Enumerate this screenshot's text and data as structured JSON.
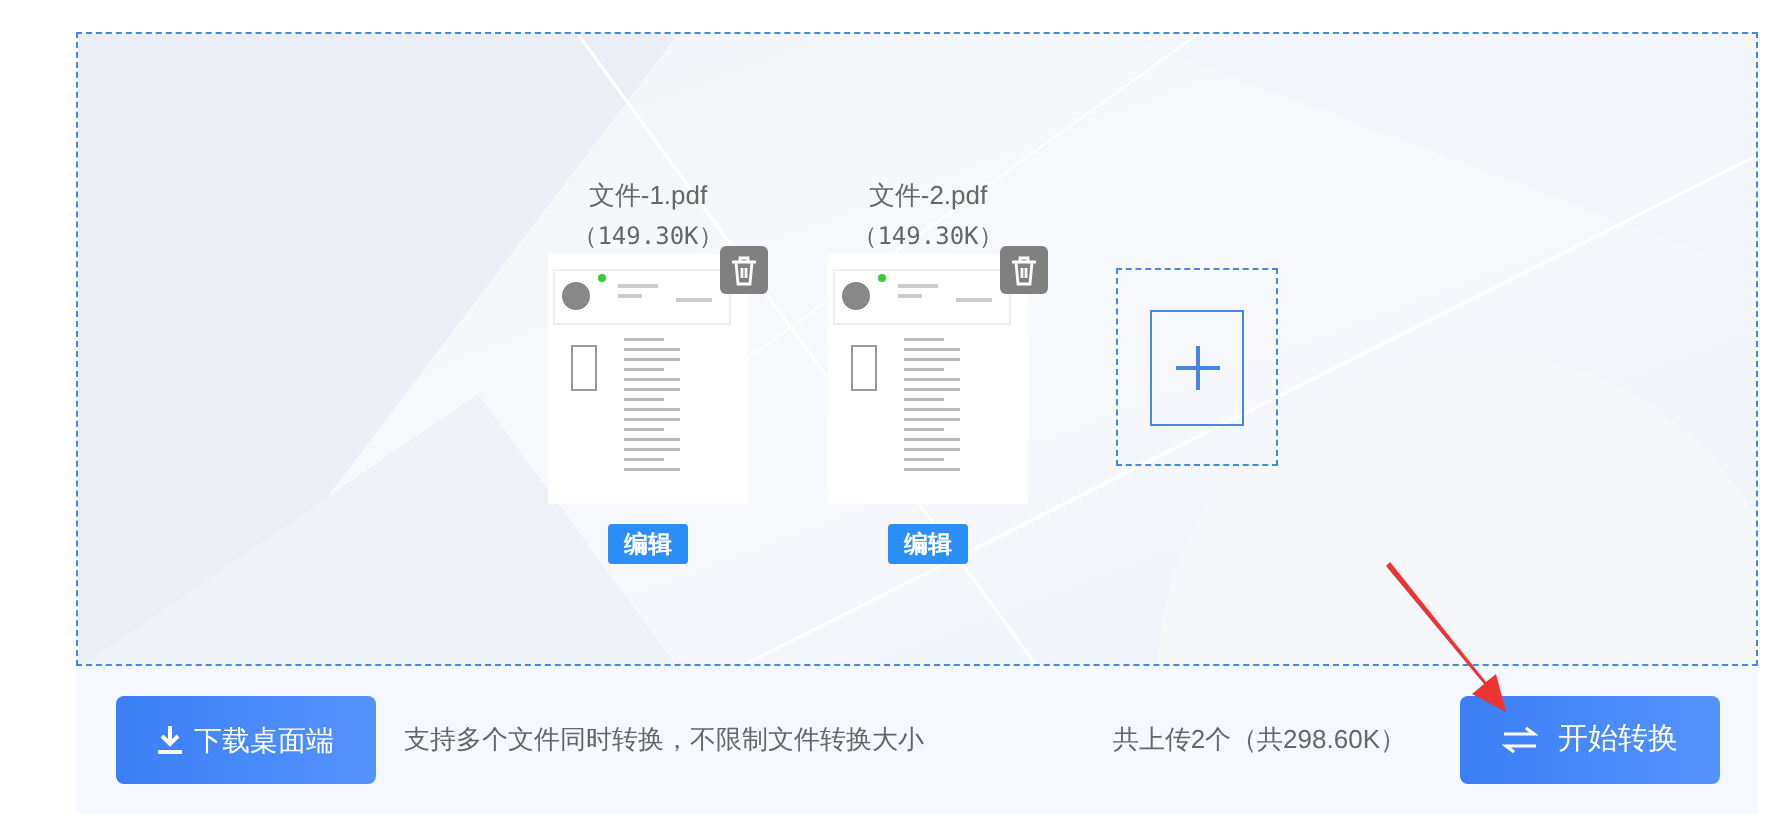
{
  "files": [
    {
      "name": "文件-1.pdf",
      "size": "（149.30K）",
      "edit_label": "编辑"
    },
    {
      "name": "文件-2.pdf",
      "size": "（149.30K）",
      "edit_label": "编辑"
    }
  ],
  "footer": {
    "download_button": "下载桌面端",
    "hint": "支持多个文件同时转换，不限制文件转换大小",
    "summary": "共上传2个（共298.60K）",
    "convert_button": "开始转换"
  }
}
